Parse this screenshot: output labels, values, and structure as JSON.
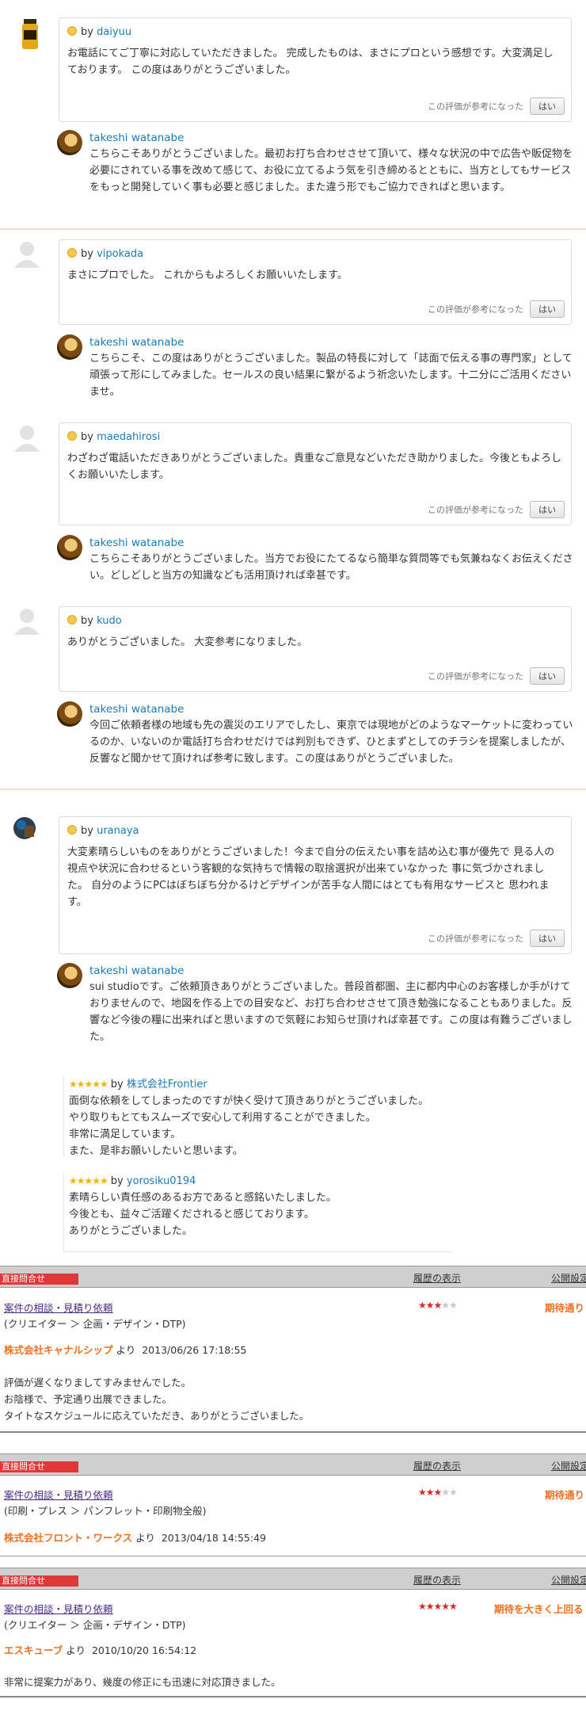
{
  "threads": [
    {
      "reviewer": "daiyuu",
      "review": "お電話にてご丁寧に対応していただきました。 完成したものは、まさにプロという感想です。大変満足しております。 この度はありがとうございました。",
      "helpful_label": "この評価が参考になった",
      "helpful_button": "はい",
      "reply_name": "takeshi watanabe",
      "reply": "こちらこそありがとうございました。最初お打ち合わせさせて頂いて、様々な状況の中で広告や販促物を必要にされている事を改めて感じて、お役に立てるよう気を引き締めるとともに、当方としてもサービスをもっと開発していく事も必要と感じました。また違う形でもご協力できればと思います。"
    },
    {
      "reviewer": "vipokada",
      "review": "まさにプロでした。 これからもよろしくお願いいたします。",
      "helpful_label": "この評価が参考になった",
      "helpful_button": "はい",
      "reply_name": "takeshi watanabe",
      "reply": "こちらこそ、この度はありがとうございました。製品の特長に対して「誌面で伝える事の専門家」として頑張って形にしてみました。セールスの良い結果に繋がるよう祈念いたします。十二分にご活用くださいませ。"
    },
    {
      "reviewer": "maedahirosi",
      "review": "わざわざ電話いただきありがとうございました。貴重なご意見などいただき助かりました。今後ともよろしくお願いいたします。",
      "helpful_label": "この評価が参考になった",
      "helpful_button": "はい",
      "reply_name": "takeshi watanabe",
      "reply": "こちらこそありがとうございました。当方でお役にたてるなら簡単な質問等でも気兼ねなくお伝えください。どしどしと当方の知識なども活用頂ければ幸甚です。"
    },
    {
      "reviewer": "kudo",
      "review": "ありがとうございました。 大変参考になりました。",
      "helpful_label": "この評価が参考になった",
      "helpful_button": "はい",
      "reply_name": "takeshi watanabe",
      "reply": "今回ご依頼者様の地域も先の震災のエリアでしたし、東京では現地がどのようなマーケットに変わっているのか、いないのか電話打ち合わせだけでは判別もできず、ひとまずとしてのチラシを提案しましたが、反響など聞かせて頂ければ参考に致します。この度はありがとうございました。"
    },
    {
      "reviewer": "uranaya",
      "review": "大変素晴らしいものをありがとうございました！今まで自分の伝えたい事を詰め込む事が優先で 見る人の視点や状況に合わせるという客観的な気持ちで情報の取捨選択が出来ていなかった 事に気づかされました。 自分のようにPCはぼちぼち分かるけどデザインが苦手な人間にはとても有用なサービスと 思われます。",
      "helpful_label": "この評価が参考になった",
      "helpful_button": "はい",
      "reply_name": "takeshi watanabe",
      "reply": "sui studioです。ご依頼頂きありがとうございました。普段首都圏、主に都内中心のお客様しか手がけておりませんので、地図を作る上での目安など、お打ち合わせさせて頂き勉強になることもありました。反響など今後の糧に出来ればと思いますので気軽にお知らせ頂ければ幸甚です。この度は有難うございました。"
    }
  ],
  "mini_reviews": [
    {
      "stars": "★★★★★",
      "by": "by",
      "reviewer": "株式会社Frontier",
      "lines": [
        "面倒な依頼をしてしまったのですが快く受けて頂きありがとうございました。",
        "やり取りもとてもスムーズで安心して利用することができました。",
        "非常に満足しています。",
        "また、是非お願いしたいと思います。"
      ]
    },
    {
      "stars": "★★★★★",
      "by": "by",
      "reviewer": "yorosiku0194",
      "lines": [
        "素晴らしい責任感のあるお方であると感銘いたしました。",
        "今後とも、益々ご活躍くだされると感じております。",
        "ありがとうございました。"
      ]
    }
  ],
  "by_word": "by",
  "consultations": [
    {
      "badge": "直接問合せ",
      "history_link": "履歴の表示",
      "public_label": "公開設定",
      "case_link": "案件の相談・見積り依頼",
      "category": "(クリエイター ＞ 企画・デザイン・DTP)",
      "stars_on": "★★★",
      "stars_off": "★★",
      "expectation": "期待通り",
      "company": "株式会社キャナルシップ",
      "from": "より",
      "datetime": "2013/06/26 17:18:55",
      "comment_lines": [
        "評価が遅くなりましてすみませんでした。",
        "お陰様で、予定通り出展できました。",
        "タイトなスケジュールに応えていただき、ありがとうございました。"
      ]
    },
    {
      "badge": "直接問合せ",
      "history_link": "履歴の表示",
      "public_label": "公開設定",
      "case_link": "案件の相談・見積り依頼",
      "category": "(印刷・プレス ＞ パンフレット・印刷物全般)",
      "stars_on": "★★★",
      "stars_off": "★★",
      "expectation": "期待通り",
      "company": "株式会社フロント・ワークス",
      "from": "より",
      "datetime": "2013/04/18 14:55:49",
      "comment_lines": []
    },
    {
      "badge": "直接問合せ",
      "history_link": "履歴の表示",
      "public_label": "公開設定",
      "case_link": "案件の相談・見積り依頼",
      "category": "(クリエイター ＞ 企画・デザイン・DTP)",
      "stars_on": "★★★★★",
      "stars_off": "",
      "expectation": "期待を大きく上回る",
      "company": "エスキューブ",
      "from": "より",
      "datetime": "2010/10/20 16:54:12",
      "comment_lines": [
        "非常に提案力があり、幾度の修正にも迅速に対応頂きました。"
      ]
    }
  ],
  "colors": {
    "link": "#1a7bb9",
    "accent_orange": "#f07020",
    "badge_red": "#e03838",
    "star_red": "#d62a2a",
    "star_yellow": "#f4b400"
  }
}
